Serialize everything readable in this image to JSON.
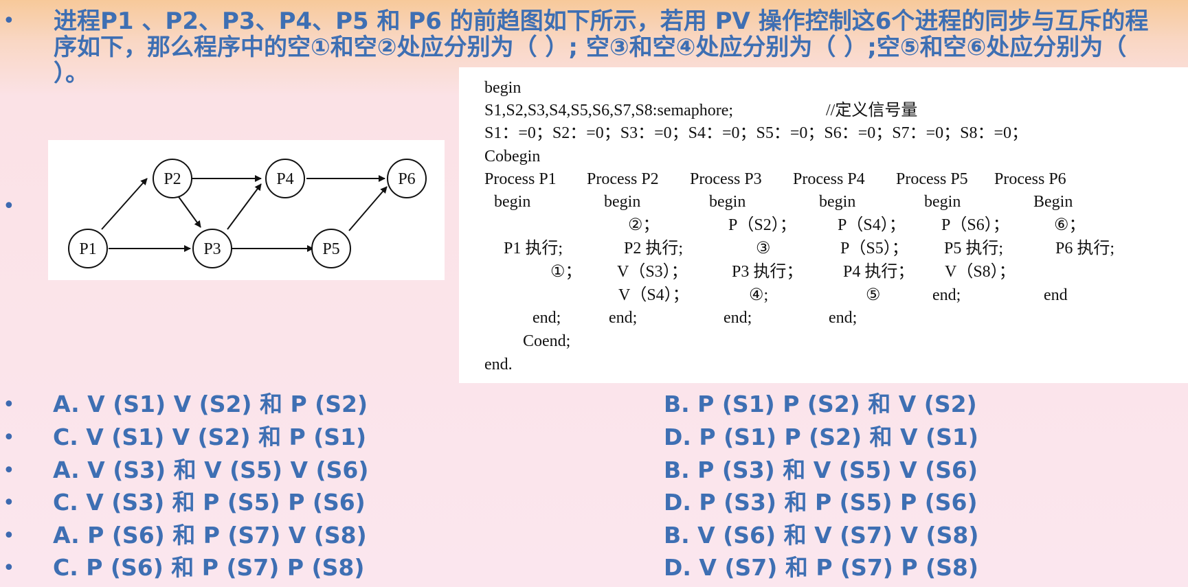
{
  "question": {
    "bullet": "•",
    "text": "进程P1 、P2、P3、P4、P5 和 P6 的前趋图如下所示，若用 PV 操作控制这6个进程的同步与互斥的程序如下，那么程序中的空①和空②处应分别为（  ）; 空③和空④处应分别为（  ）;空⑤和空⑥处应分别为（  ）。"
  },
  "graph": {
    "nodes": [
      "P1",
      "P2",
      "P3",
      "P4",
      "P5",
      "P6"
    ]
  },
  "code": {
    "begin": "begin",
    "decl": "S1,S2,S3,S4,S5,S6,S7,S8:semaphore;",
    "decl_comment": "//定义信号量",
    "init": "S1：=0；S2：=0；S3：=0；S4：=0；S5：=0；S6：=0；S7：=0；S8：=0；",
    "cobegin": "Cobegin",
    "procs": [
      "Process P1",
      "Process P2",
      "Process P3",
      "Process P4",
      "Process P5",
      "Process P6"
    ],
    "proc_begin": [
      "begin",
      "begin",
      "begin",
      "begin",
      "begin",
      "Begin"
    ],
    "r3": [
      "②；",
      "P（S2）；",
      "P（S4）；",
      "P（S6）；",
      "⑥；"
    ],
    "r4": [
      "P1 执行;",
      "P2 执行;",
      "③",
      "P（S5）；",
      "P5 执行;",
      "P6 执行;"
    ],
    "r5": [
      "①；",
      "V（S3）；",
      "P3 执行；",
      "P4 执行；",
      "V（S8）；"
    ],
    "r6": [
      "V（S4）；",
      "④;",
      "⑤",
      "end;",
      "end"
    ],
    "r7": [
      "end;",
      "end;",
      "end;",
      "end;"
    ],
    "coend": "Coend;",
    "end": "end."
  },
  "options": [
    {
      "left": "A. V (S1) V (S2) 和 P (S2)",
      "right": "B. P (S1) P (S2) 和 V (S2)"
    },
    {
      "left": "C. V (S1) V (S2) 和 P (S1)",
      "right": "D. P (S1) P (S2) 和 V (S1)"
    },
    {
      "left": "A. V (S3) 和 V (S5) V (S6)",
      "right": "B. P (S3) 和 V (S5) V (S6)"
    },
    {
      "left": "C. V (S3) 和 P (S5) P (S6)",
      "right": "D. P (S3) 和 P (S5) P (S6)"
    },
    {
      "left": "A. P (S6) 和 P (S7) V (S8)",
      "right": "B. V (S6) 和 V (S7) V (S8)"
    },
    {
      "left": "C. P (S6) 和 P (S7) P (S8)",
      "right": "D. V (S7) 和 P (S7) P (S8)"
    }
  ],
  "bullet_char": "•"
}
